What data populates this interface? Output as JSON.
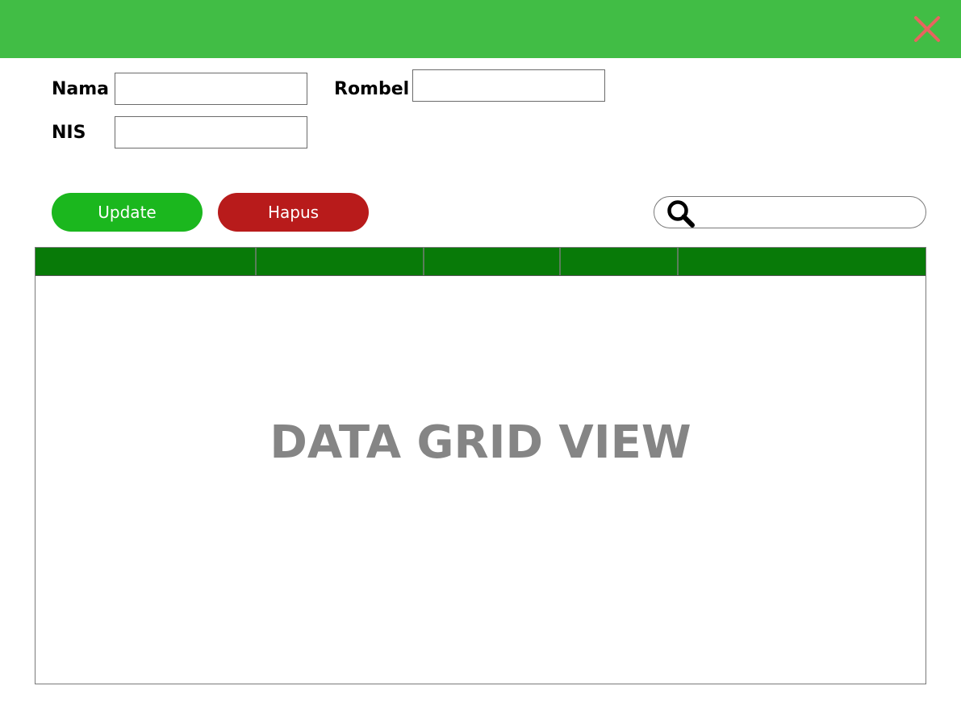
{
  "window": {
    "title_bar_color": "#41bd45",
    "close_icon": "close-icon",
    "close_icon_color": "#e8645f"
  },
  "form": {
    "nama_label": "Nama",
    "nama_value": "",
    "nis_label": "NIS",
    "nis_value": "",
    "rombel_label": "Rombel",
    "rombel_value": ""
  },
  "actions": {
    "update_label": "Update",
    "update_color": "#1bb71e",
    "delete_label": "Hapus",
    "delete_color": "#b81b1b"
  },
  "search": {
    "icon": "search-icon",
    "value": ""
  },
  "grid": {
    "header_color": "#087a08",
    "columns": [
      "",
      "",
      "",
      "",
      ""
    ],
    "placeholder_text": "DATA GRID VIEW"
  }
}
